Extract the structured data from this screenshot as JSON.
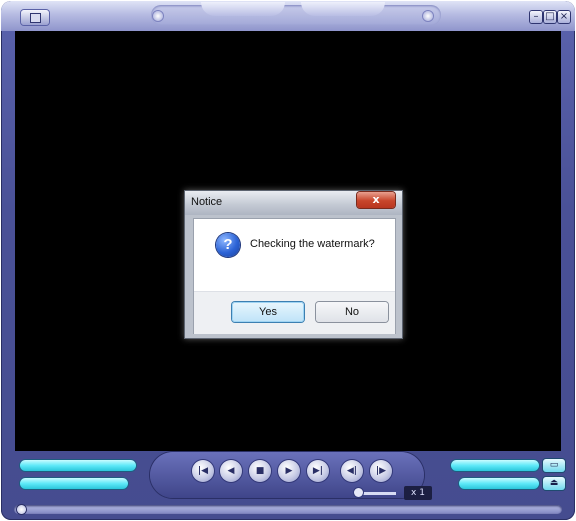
{
  "window": {
    "minimize_glyph": "–",
    "maximize_glyph": "□",
    "close_glyph": "×"
  },
  "dialog": {
    "title": "Notice",
    "close_glyph": "x",
    "message": "Checking the watermark?",
    "icon": "question-icon",
    "icon_glyph": "?",
    "yes_label": "Yes",
    "no_label": "No"
  },
  "controls": {
    "buttons": [
      {
        "name": "skip-back-icon",
        "glyph": "|◀"
      },
      {
        "name": "rewind-icon",
        "glyph": "◀"
      },
      {
        "name": "stop-icon",
        "glyph": "■"
      },
      {
        "name": "play-icon",
        "glyph": "▶"
      },
      {
        "name": "skip-forward-icon",
        "glyph": "▶|"
      },
      {
        "name": "frame-back-icon",
        "glyph": "◀|"
      },
      {
        "name": "frame-forward-icon",
        "glyph": "|▶"
      }
    ],
    "speed": "x 1",
    "open_icon": "folder-icon",
    "open_glyph": "▭",
    "eject_icon": "eject-icon",
    "eject_glyph": "⏏"
  },
  "colors": {
    "frame": "#4a5197",
    "screen": "#000000",
    "accent_bar": "#5ee9f8"
  }
}
